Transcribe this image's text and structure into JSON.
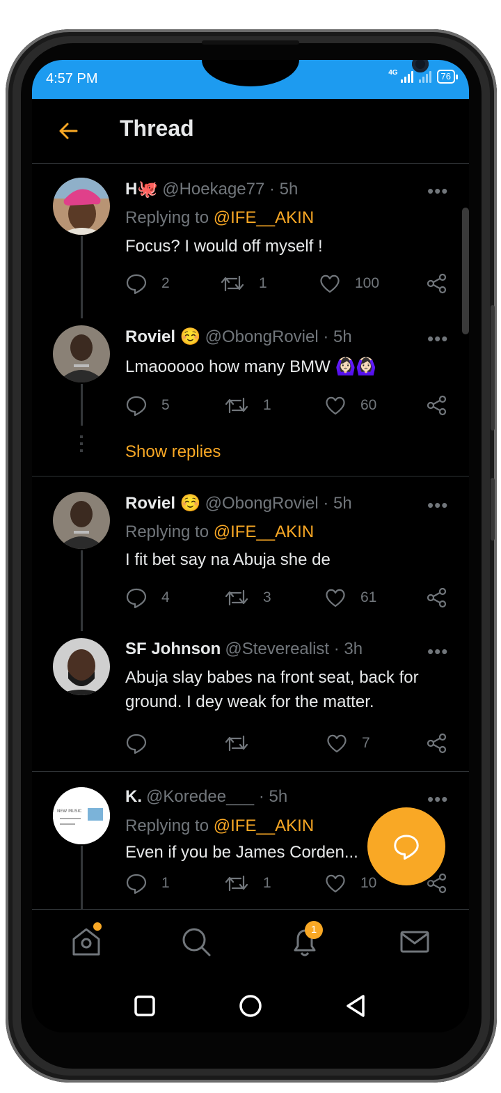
{
  "status_bar": {
    "time": "4:57 PM",
    "network": "4G",
    "battery": "76"
  },
  "header": {
    "title": "Thread"
  },
  "tweets": [
    {
      "name": "H🐙",
      "handle": "@Hoekage77 · 5h",
      "replying_prefix": "Replying to ",
      "replying_to": "@IFE__AKIN",
      "text": "Focus? I would off myself !",
      "replies": "2",
      "retweets": "1",
      "likes": "100"
    },
    {
      "name": "Roviel ☺️",
      "handle": "@ObongRoviel · 5h",
      "text": "Lmaooooo how many BMW 🙆🏻‍♀️🙆🏻‍♀️",
      "replies": "5",
      "retweets": "1",
      "likes": "60"
    },
    {
      "name": "Roviel ☺️",
      "handle": "@ObongRoviel · 5h",
      "replying_prefix": "Replying to ",
      "replying_to": "@IFE__AKIN",
      "text": "I fit bet say na Abuja she de",
      "replies": "4",
      "retweets": "3",
      "likes": "61"
    },
    {
      "name": "SF Johnson",
      "handle": "@Steverealist · 3h",
      "text": "Abuja slay babes na front seat, back for ground. I dey weak for the matter.",
      "replies": "",
      "retweets": "",
      "likes": "7"
    },
    {
      "name": "K.",
      "handle": "@Koredee___ · 5h",
      "replying_prefix": "Replying to ",
      "replying_to": "@IFE__AKIN",
      "text": "Even if you be James Corden...",
      "replies": "1",
      "retweets": "1",
      "likes": "10"
    }
  ],
  "show_replies": "Show replies",
  "more_glyph": "•••",
  "avatar_text": {
    "line1": "NEW MUSIC"
  },
  "bottom_nav": {
    "notifications_badge": "1"
  },
  "colors": {
    "accent": "#f9a825",
    "status_bar": "#1d9bf0",
    "background": "#000000",
    "muted": "#71767b"
  }
}
